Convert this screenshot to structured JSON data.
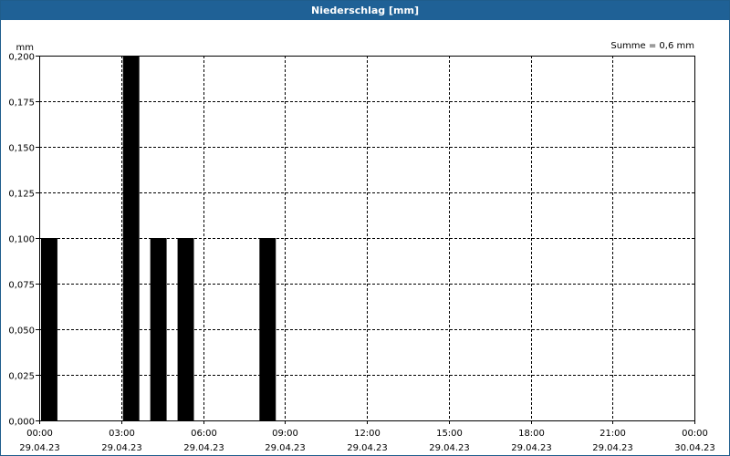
{
  "window": {
    "title": "Niederschlag [mm]"
  },
  "chart_data": {
    "type": "bar",
    "title": "Niederschlag [mm]",
    "ylabel": "mm",
    "xlabel": "",
    "annotation": "Summe = 0,6 mm",
    "ylim": [
      0,
      0.2
    ],
    "y_ticks": [
      0,
      0.025,
      0.05,
      0.075,
      0.1,
      0.125,
      0.15,
      0.175,
      0.2
    ],
    "y_tick_labels": [
      "0,000",
      "0,025",
      "0,050",
      "0,075",
      "0,100",
      "0,125",
      "0,150",
      "0,175",
      "0,200"
    ],
    "x_range_hours": [
      0,
      24
    ],
    "x_ticks": [
      {
        "hour": 0,
        "time": "00:00",
        "date": "29.04.23"
      },
      {
        "hour": 3,
        "time": "03:00",
        "date": "29.04.23"
      },
      {
        "hour": 6,
        "time": "06:00",
        "date": "29.04.23"
      },
      {
        "hour": 9,
        "time": "09:00",
        "date": "29.04.23"
      },
      {
        "hour": 12,
        "time": "12:00",
        "date": "29.04.23"
      },
      {
        "hour": 15,
        "time": "15:00",
        "date": "29.04.23"
      },
      {
        "hour": 18,
        "time": "18:00",
        "date": "29.04.23"
      },
      {
        "hour": 21,
        "time": "21:00",
        "date": "29.04.23"
      },
      {
        "hour": 24,
        "time": "00:00",
        "date": "30.04.23"
      }
    ],
    "bars": [
      {
        "hour": 0,
        "value": 0.1
      },
      {
        "hour": 3,
        "value": 0.2
      },
      {
        "hour": 4,
        "value": 0.1
      },
      {
        "hour": 5,
        "value": 0.1
      },
      {
        "hour": 8,
        "value": 0.1
      }
    ],
    "bar_color": "#000000",
    "grid": true
  }
}
